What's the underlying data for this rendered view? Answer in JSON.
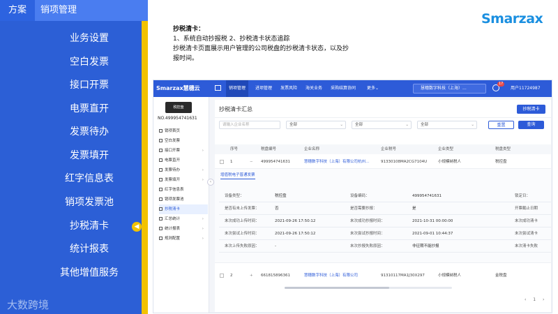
{
  "left_panel": {
    "tag": "方案",
    "title": "销项管理",
    "items": [
      "业务设置",
      "空白发票",
      "接口开票",
      "电票直开",
      "发票待办",
      "发票填开",
      "红字信息表",
      "销项发票池",
      "抄税清卡",
      "统计报表",
      "其他增值服务"
    ],
    "active_index": 8,
    "brand": "大数跨境"
  },
  "description": {
    "heading": "抄税清卡：",
    "line1": "1、系统自动抄报税   2、抄税清卡状态追踪",
    "line2": "抄税清卡页面展示用户管理的公司税盘的抄税清卡状态，以及抄",
    "line3": "报时间。"
  },
  "logo_text": "Smarzax",
  "app": {
    "brand": "Smarzax慧穗云",
    "nav": [
      "销项管理",
      "进项管理",
      "发票风险",
      "海关业务",
      "采购结算协同",
      "更多"
    ],
    "active_nav": 0,
    "company_select": "慧穗数字科技（上海）...",
    "notif_count": "17",
    "user": "用户11724987",
    "device_label": "税控盘",
    "device_no": "NO.499954741631",
    "side": [
      {
        "label": "销项首页",
        "arrow": false
      },
      {
        "label": "空白发票",
        "arrow": false
      },
      {
        "label": "接口开票",
        "arrow": true
      },
      {
        "label": "电票直开",
        "arrow": false
      },
      {
        "label": "发票待办",
        "arrow": true
      },
      {
        "label": "发票填开",
        "arrow": true
      },
      {
        "label": "红字信息表",
        "arrow": false
      },
      {
        "label": "销项发票池",
        "arrow": false
      },
      {
        "label": "抄税清卡",
        "arrow": false
      },
      {
        "label": "汇总统计",
        "arrow": true
      },
      {
        "label": "统计报表",
        "arrow": true
      },
      {
        "label": "规则配置",
        "arrow": true
      }
    ],
    "active_side": 8,
    "page_title": "抄税清卡汇总",
    "action_button": "抄税清卡",
    "filters": {
      "company_placeholder": "请输入企业名称",
      "f1": "全部",
      "f2": "全部",
      "f3": "全部",
      "reset": "重置",
      "query": "查询"
    },
    "columns": [
      "序号",
      "税盘编号",
      "企业名称",
      "企业税号",
      "企业类型",
      "税盘类型"
    ],
    "rows": [
      {
        "no": "1",
        "disk": "499954741631",
        "company": "慧穗数字科技（上海）有限公司杭州...",
        "tax_id": "91330108MA2CG7104U",
        "type": "小规模纳税人",
        "disk_type": "税控盘"
      },
      {
        "no": "2",
        "disk": "661815896361",
        "company": "慧穗数字科技（上海）有限公司",
        "tax_id": "91310117MA1J30X297",
        "type": "小规模纳税人",
        "disk_type": "金税盘"
      }
    ],
    "detail_tab": "增值税电子普通发票",
    "detail": [
      {
        "k1": "设备类型：",
        "v1": "税控盘",
        "k2": "设备编码：",
        "v2": "499954741631",
        "k3": "锁定日："
      },
      {
        "k1": "是否有未上传发票：",
        "v1": "否",
        "k2": "是否需要抄报：",
        "v2": "是",
        "k3": "开票截止日期"
      },
      {
        "k1": "末次成功上传时间：",
        "v1": "2021-09-26 17:50:12",
        "k2": "末次成功抄报时间：",
        "v2": "2021-10-31 00:00:00",
        "k3": "末次成功清卡"
      },
      {
        "k1": "末次尝试上传时间：",
        "v1": "2021-09-26 17:50:12",
        "k2": "末次尝试抄报时间：",
        "v2": "2021-09-01 10:44:37",
        "k3": "末次尝试清卡"
      },
      {
        "k1": "末次上传失败原因：",
        "v1": "-",
        "k2": "末次抄报失败原因：",
        "v2": "非征期不能抄报",
        "k3": "末次清卡失败"
      }
    ]
  }
}
